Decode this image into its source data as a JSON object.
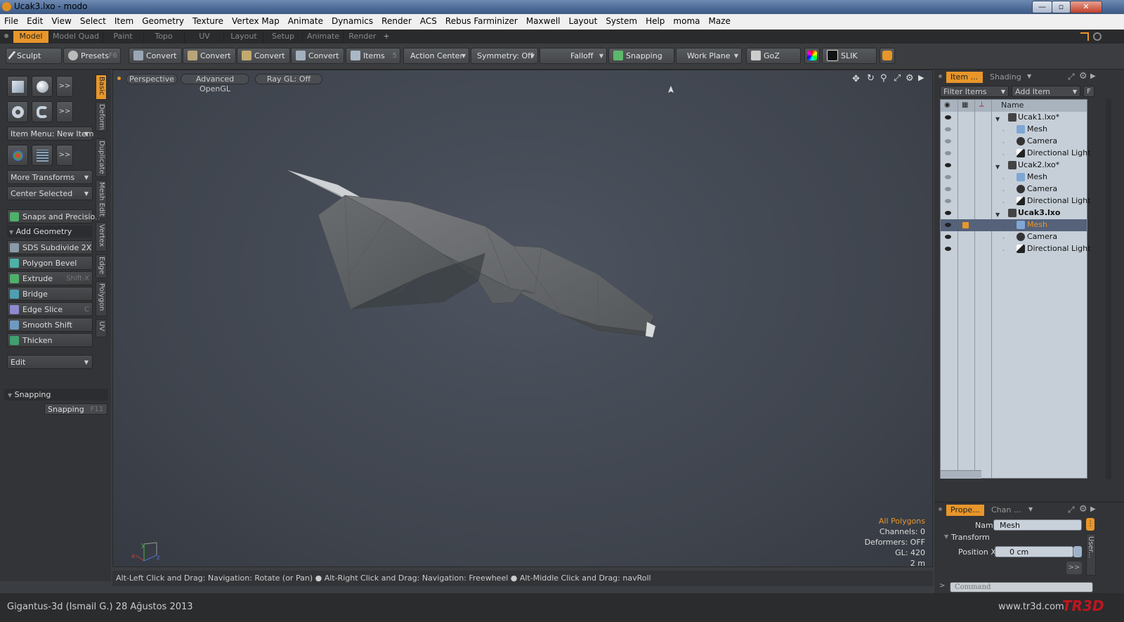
{
  "window": {
    "title": "Ucak3.lxo - modo",
    "min": "—",
    "max": "▫",
    "close": "✕"
  },
  "menu": [
    "File",
    "Edit",
    "View",
    "Select",
    "Item",
    "Geometry",
    "Texture",
    "Vertex Map",
    "Animate",
    "Dynamics",
    "Render",
    "ACS",
    "Rebus Farminizer",
    "Maxwell",
    "Layout",
    "System",
    "Help",
    "moma",
    "Maze"
  ],
  "layout_tabs": [
    "Model",
    "Model Quad",
    "Paint",
    "Topo",
    "UV",
    "Layout",
    "Setup",
    "Animate",
    "Render",
    "+"
  ],
  "layout_active": "Model",
  "toolbar": {
    "sculpt": "Sculpt",
    "presets": "Presets",
    "presets_key": "F6",
    "convert1": "Convert",
    "convert2": "Convert",
    "convert3": "Convert",
    "convert4": "Convert",
    "items": "Items",
    "items_key": "5",
    "action_center": "Action Center",
    "symmetry": "Symmetry: Off",
    "falloff": "Falloff",
    "snapping": "Snapping",
    "work_plane": "Work Plane",
    "goz": "GoZ",
    "slik": "SLIK"
  },
  "left": {
    "more_btn": ">>",
    "item_menu": "Item Menu: New Item",
    "more_transforms": "More Transforms",
    "center_selected": "Center Selected",
    "snaps_precision": "Snaps and Precision",
    "add_geometry": "Add Geometry",
    "tools": [
      {
        "label": "SDS Subdivide 2X",
        "key": "",
        "color": "#8a9aa8"
      },
      {
        "label": "Polygon Bevel",
        "key": "",
        "color": "#4fb0a6"
      },
      {
        "label": "Extrude",
        "key": "Shift-X",
        "color": "#4fb06a"
      },
      {
        "label": "Bridge",
        "key": "",
        "color": "#4f9fb0"
      },
      {
        "label": "Edge Slice",
        "key": "C",
        "color": "#8f8ad0"
      },
      {
        "label": "Smooth Shift",
        "key": "",
        "color": "#6f9ac0"
      },
      {
        "label": "Thicken",
        "key": "",
        "color": "#3fa070"
      }
    ],
    "edit": "Edit",
    "snapping_header": "Snapping",
    "snapping_btn": "Snapping",
    "snapping_key": "F11",
    "vtabs": [
      "Basic",
      "Deform",
      "Duplicate",
      "Mesh Edit",
      "Vertex",
      "Edge",
      "Polygon",
      "UV"
    ]
  },
  "viewport": {
    "perspective": "Perspective",
    "opengl": "Advanced OpenGL",
    "raygl": "Ray GL: Off",
    "info_mode": "All Polygons",
    "channels": "Channels: 0",
    "deformers": "Deformers: OFF",
    "gl": "GL: 420",
    "scale": "2 m",
    "accent": "#e8962a"
  },
  "status_hint": "Alt-Left Click and Drag: Navigation: Rotate (or Pan) ● Alt-Right Click and Drag: Navigation: Freewheel ● Alt-Middle Click and Drag: navRoll",
  "right": {
    "tab_item": "Item ...",
    "tab_shading": "Shading",
    "filter_items": "Filter Items",
    "add_item": "Add Item",
    "f_btn": "F",
    "col_name": "Name",
    "tree": [
      {
        "label": "Ucak1.lxo*",
        "type": "scene",
        "bold": false,
        "selected": false
      },
      {
        "label": "Mesh",
        "type": "mesh",
        "bold": false,
        "selected": false
      },
      {
        "label": "Camera",
        "type": "camera",
        "bold": false,
        "selected": false
      },
      {
        "label": "Directional Light",
        "type": "light",
        "bold": false,
        "selected": false
      },
      {
        "label": "Ucak2.lxo*",
        "type": "scene",
        "bold": false,
        "selected": false
      },
      {
        "label": "Mesh",
        "type": "mesh",
        "bold": false,
        "selected": false
      },
      {
        "label": "Camera",
        "type": "camera",
        "bold": false,
        "selected": false
      },
      {
        "label": "Directional Light",
        "type": "light",
        "bold": false,
        "selected": false
      },
      {
        "label": "Ucak3.lxo",
        "type": "scene",
        "bold": true,
        "selected": false
      },
      {
        "label": "Mesh",
        "type": "mesh",
        "bold": false,
        "selected": true
      },
      {
        "label": "Camera",
        "type": "camera",
        "bold": false,
        "selected": false
      },
      {
        "label": "Directional Light",
        "type": "light",
        "bold": false,
        "selected": false
      }
    ],
    "tab_props": "Prope...",
    "tab_chan": "Chan ...",
    "name_label": "Name",
    "name_value": "Mesh",
    "transform": "Transform",
    "pos_x_label": "Position X",
    "pos_x_value": "0 cm",
    "user_tab": "User...",
    "more": ">>",
    "command_placeholder": "Command"
  },
  "footer": {
    "credit": "Gigantus-3d (Ismail G.)  28 Ağustos 2013",
    "site": "www.tr3d.com",
    "logo": "TR3D"
  }
}
